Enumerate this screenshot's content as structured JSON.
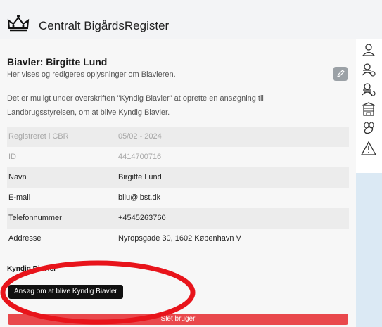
{
  "app": {
    "title": "Centralt BigårdsRegister"
  },
  "profile": {
    "heading": "Biavler: Birgitte Lund",
    "subtitle": "Her vises og redigeres oplysninger om Biavleren.",
    "description": "Det er muligt under overskriften \"Kyndig Biavler\" at oprette en ansøgning til Landbrugsstyrelsen, om at blive Kyndig Biavler."
  },
  "fields": [
    {
      "label": "Registreret i CBR",
      "value": "05/02 - 2024"
    },
    {
      "label": "ID",
      "value": "4414700716"
    },
    {
      "label": "Navn",
      "value": "Birgitte Lund"
    },
    {
      "label": "E-mail",
      "value": "bilu@lbst.dk"
    },
    {
      "label": "Telefonnummer",
      "value": "+4545263760"
    },
    {
      "label": "Addresse",
      "value": "Nyropsgade 30, 1602 København V"
    }
  ],
  "kyndig": {
    "section_label": "Kyndig Biavler",
    "apply_button": "Ansøg om at blive Kyndig Biavler"
  },
  "delete_button": "Slet bruger",
  "colors": {
    "accent_red": "#e9484c",
    "rail_blue": "#dbe9f4",
    "annotation_red": "#e8141b"
  },
  "icons": [
    "crown-logo-icon",
    "user-icon",
    "beekeeper-settings-icon",
    "beekeeper-refresh-icon",
    "apiary-icon",
    "bee-icon",
    "warning-icon",
    "pencil-icon"
  ]
}
